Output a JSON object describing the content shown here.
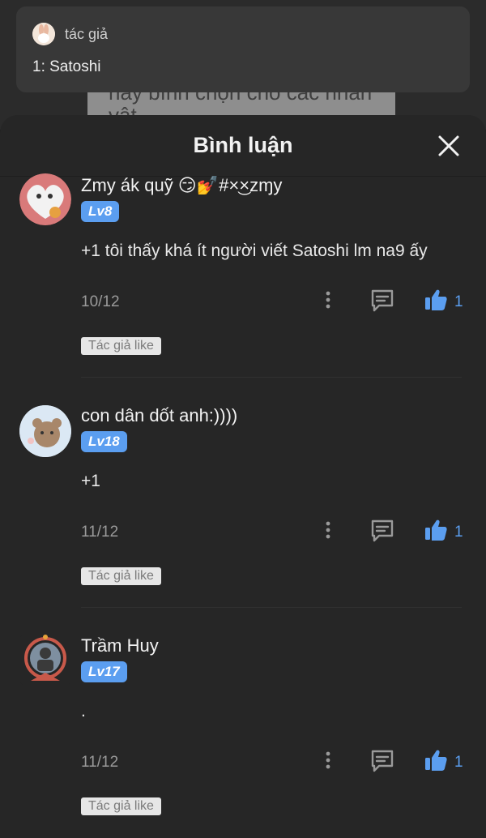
{
  "background": {
    "card_text": "hay bình chọn cho các nhân vật"
  },
  "author_popup": {
    "label": "tác giả",
    "value": "1: Satoshi"
  },
  "sheet": {
    "title": "Bình luận",
    "close_icon": "close-icon"
  },
  "comments": [
    {
      "name": "Zmy ák quỹ 😏💅#×͜×zɱy",
      "level": "Lv8",
      "text": "+1 tôi thấy khá ít người viết Satoshi lm na9 ấy",
      "date": "10/12",
      "likes": "1",
      "author_tag": "Tác giả like"
    },
    {
      "name": "con dân dốt anh:))))",
      "level": "Lv18",
      "text": "+1",
      "date": "11/12",
      "likes": "1",
      "author_tag": "Tác giả like"
    },
    {
      "name": "Trầm Huy",
      "level": "Lv17",
      "text": ".",
      "date": "11/12",
      "likes": "1",
      "author_tag": "Tác giả like"
    }
  ],
  "colors": {
    "accent": "#5b9ef0",
    "sheet_bg": "#262626",
    "popup_bg": "#383838"
  }
}
